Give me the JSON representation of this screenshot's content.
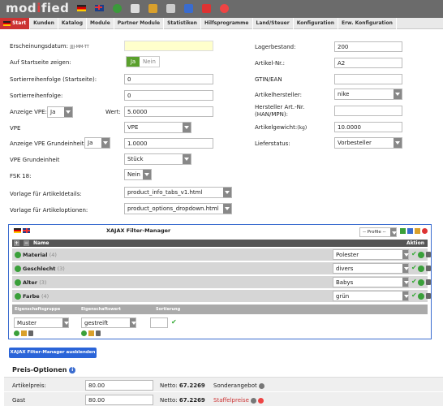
{
  "app": {
    "logo_prefix": "mod",
    "logo_accent": "i",
    "logo_suffix": "fied"
  },
  "nav": {
    "tabs": [
      "Start",
      "Kunden",
      "Katalog",
      "Module",
      "Partner Module",
      "Statistiken",
      "Hilfsprogramme",
      "Land/Steuer",
      "Konfiguration",
      "Erw. Konfiguration"
    ]
  },
  "form": {
    "erscheinungsdatum_label": "Erscheinungsdatum:",
    "erscheinungsdatum_hint": "JJJJ-MM-TT",
    "erscheinungsdatum_value": "",
    "startseite_label": "Auf Startseite zeigen:",
    "startseite_yes": "Ja",
    "startseite_no": "Nein",
    "sort_startseite_label": "Sortierreihenfolge (Startseite):",
    "sort_startseite_value": "0",
    "sort_label": "Sortierreihenfolge:",
    "sort_value": "0",
    "anzeige_vpe_label": "Anzeige VPE:",
    "anzeige_vpe_value": "Ja",
    "wert_label": "Wert:",
    "wert_value": "5.0000",
    "vpe_label": "VPE",
    "vpe_value": "VPE",
    "anzeige_vpe_ge_label": "Anzeige VPE Grundeinheit:",
    "anzeige_vpe_ge_value": "Ja",
    "anzeige_vpe_ge_amount": "1.0000",
    "vpe_ge_label": "VPE Grundeinheit",
    "vpe_ge_value": "Stück",
    "fsk_label": "FSK 18:",
    "fsk_value": "Nein",
    "vorlage_details_label": "Vorlage für Artikeldetails:",
    "vorlage_details_value": "product_info_tabs_v1.html",
    "vorlage_optionen_label": "Vorlage für Artikeloptionen:",
    "vorlage_optionen_value": "product_options_dropdown.html",
    "lagerbestand_label": "Lagerbestand:",
    "lagerbestand_value": "200",
    "artikelnr_label": "Artikel-Nr.:",
    "artikelnr_value": "A2",
    "gtin_label": "GTIN/EAN",
    "gtin_value": "",
    "hersteller_label": "Artikelhersteller:",
    "hersteller_value": "nike",
    "hersteller_nr_label": "Hersteller Art.-Nr. (HAN/MPN):",
    "hersteller_nr_value": "",
    "gewicht_label": "Artikelgewicht:",
    "gewicht_unit": "(kg)",
    "gewicht_value": "10.0000",
    "lieferstatus_label": "Lieferstatus:",
    "lieferstatus_value": "Vorbesteller"
  },
  "filter_manager": {
    "title": "XAJAX Filter-Manager",
    "profile_select": "-- Profile --",
    "col_name": "Name",
    "col_action": "Aktion",
    "rows": [
      {
        "name": "Material",
        "count": "(4)",
        "value": "Polester"
      },
      {
        "name": "Geschlecht",
        "count": "(3)",
        "value": "divers"
      },
      {
        "name": "Alter",
        "count": "(3)",
        "value": "Babys"
      },
      {
        "name": "Farbe",
        "count": "(4)",
        "value": "grün"
      }
    ],
    "sub_headers": [
      "Eigenschaftsgruppe",
      "Eigenschaftswert",
      "Sortierung"
    ],
    "new_group_value": "Muster",
    "new_value_value": "gestreift",
    "new_sort_value": "",
    "hide_button": "XAJAX Filter-Manager ausblenden"
  },
  "prices": {
    "title": "Preis-Optionen",
    "rows": [
      {
        "label": "Artikelpreis:",
        "value": "80.00",
        "netto_label": "Netto:",
        "netto_value": "67.2269",
        "extra": "Sonderangebot"
      },
      {
        "label": "Gast",
        "value": "80.00",
        "netto_label": "Netto:",
        "netto_value": "67.2269",
        "extra": "Staffelpreise"
      }
    ]
  },
  "colors": {
    "accent": "#cc3333",
    "filter_border": "#3a6ccf",
    "button_blue": "#2a64d8",
    "toggle_green": "#5aa02c"
  }
}
